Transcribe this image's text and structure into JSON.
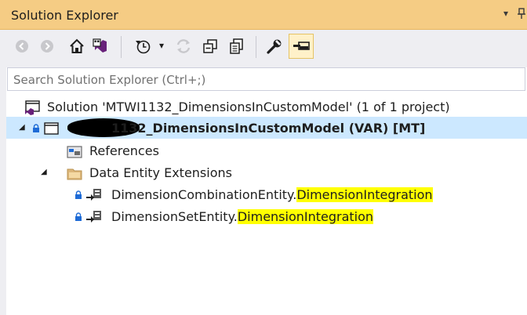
{
  "window": {
    "title": "Solution Explorer",
    "title_menu_glyph": "▾"
  },
  "toolbar": {
    "buttons": [
      {
        "name": "back-button",
        "icon": "arrow-left-icon"
      },
      {
        "name": "forward-button",
        "icon": "arrow-right-icon"
      },
      {
        "name": "home-button",
        "icon": "home-icon"
      },
      {
        "name": "switch-views-button",
        "icon": "visual-studio-icon"
      },
      {
        "name": "pending-changes-filter-button",
        "icon": "clock-icon"
      },
      {
        "name": "sync-button",
        "icon": "sync-icon"
      },
      {
        "name": "collapse-all-button",
        "icon": "collapse-all-icon"
      },
      {
        "name": "show-all-files-button",
        "icon": "copy-files-icon"
      },
      {
        "name": "properties-button",
        "icon": "wrench-icon"
      },
      {
        "name": "preview-selected-button",
        "icon": "preview-icon",
        "active": true
      }
    ],
    "dropdown_glyph": "▾"
  },
  "search": {
    "placeholder": "Search Solution Explorer (Ctrl+;)"
  },
  "tree": {
    "solution": "Solution 'MTWI1132_DimensionsInCustomModel' (1 of 1 project)",
    "project": "1132_DimensionsInCustomModel (VAR) [MT]",
    "references": "References",
    "folder": "Data Entity Extensions",
    "items": [
      {
        "prefix": "DimensionCombinationEntity.",
        "highlight": "DimensionIntegration"
      },
      {
        "prefix": "DimensionSetEntity.",
        "highlight": "DimensionIntegration"
      }
    ],
    "expanded_glyph": "◢",
    "highlight_color": "#ffff00",
    "selection_color": "#cce8ff"
  }
}
